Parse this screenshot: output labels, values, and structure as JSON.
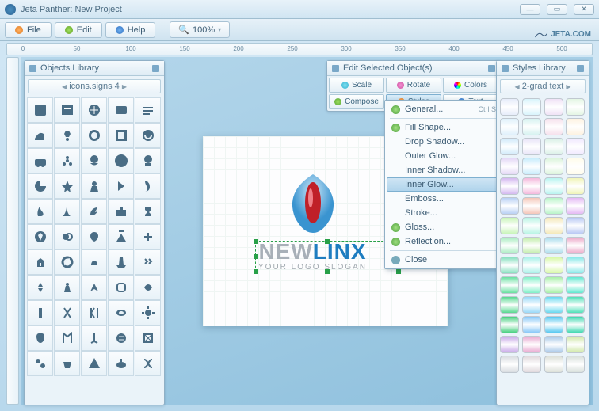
{
  "window": {
    "title": "Jeta Panther: New Project"
  },
  "menubar": {
    "file": "File",
    "edit": "Edit",
    "help": "Help",
    "zoom": "100%"
  },
  "brand": "JETA.COM",
  "ruler_marks": [
    "0",
    "50",
    "100",
    "150",
    "200",
    "250",
    "300",
    "350",
    "400",
    "450",
    "500"
  ],
  "objects": {
    "title": "Objects Library",
    "selector": "icons.signs 4"
  },
  "styles_panel": {
    "title": "Styles Library",
    "selector": "2-grad text"
  },
  "edit_panel": {
    "title": "Edit Selected Object(s)",
    "scale": "Scale",
    "rotate": "Rotate",
    "colors": "Colors",
    "compose": "Compose",
    "styles": "Styles",
    "text": "Text"
  },
  "dropdown": {
    "general": "General...",
    "general_sc": "Ctrl S",
    "fill": "Fill Shape...",
    "drop": "Drop Shadow...",
    "outerglow": "Outer Glow...",
    "innershadow": "Inner Shadow...",
    "innerglow": "Inner Glow...",
    "emboss": "Emboss...",
    "stroke": "Stroke...",
    "gloss": "Gloss...",
    "reflection": "Reflection...",
    "close": "Close"
  },
  "canvas": {
    "logo_a": "NEW",
    "logo_b": "LINX",
    "slogan": "YOUR LOGO SLOGAN"
  },
  "style_colors": [
    "#e6ecfa",
    "#d8f4fc",
    "#f0e2f6",
    "#e4f6e4",
    "#dff0fb",
    "#d6f2f0",
    "#f6e0ec",
    "#fdf2e0",
    "#d0eafa",
    "#e8e4f8",
    "#d8f0e6",
    "#f0e8ff",
    "#e4d8f6",
    "#c8ecfc",
    "#dcf4dc",
    "#fffceb",
    "#d4b8f0",
    "#f4b8dc",
    "#b8f4f0",
    "#f0f4b8",
    "#b8d0f4",
    "#f4c6b8",
    "#b8f4c8",
    "#e4b8f4",
    "#c8f4b8",
    "#b8f4e4",
    "#f4e8b8",
    "#b8c8f4",
    "#a8ecc0",
    "#c0eca8",
    "#a8dcec",
    "#eca8c8",
    "#88e0c0",
    "#a8f0e8",
    "#d8f8a8",
    "#88e8e8",
    "#68e0a0",
    "#80f0c8",
    "#a8f0a8",
    "#60e8d0",
    "#58d890",
    "#98d8f8",
    "#68d8f0",
    "#50e0b8",
    "#48d080",
    "#88c8f8",
    "#58c8f0",
    "#40d8b0",
    "#c8a8e8",
    "#e8a8d0",
    "#a8c8e8",
    "#d0e8a8",
    "#d8dce0",
    "#e0d8dc",
    "#dce0d8",
    "#d8e0dc"
  ]
}
